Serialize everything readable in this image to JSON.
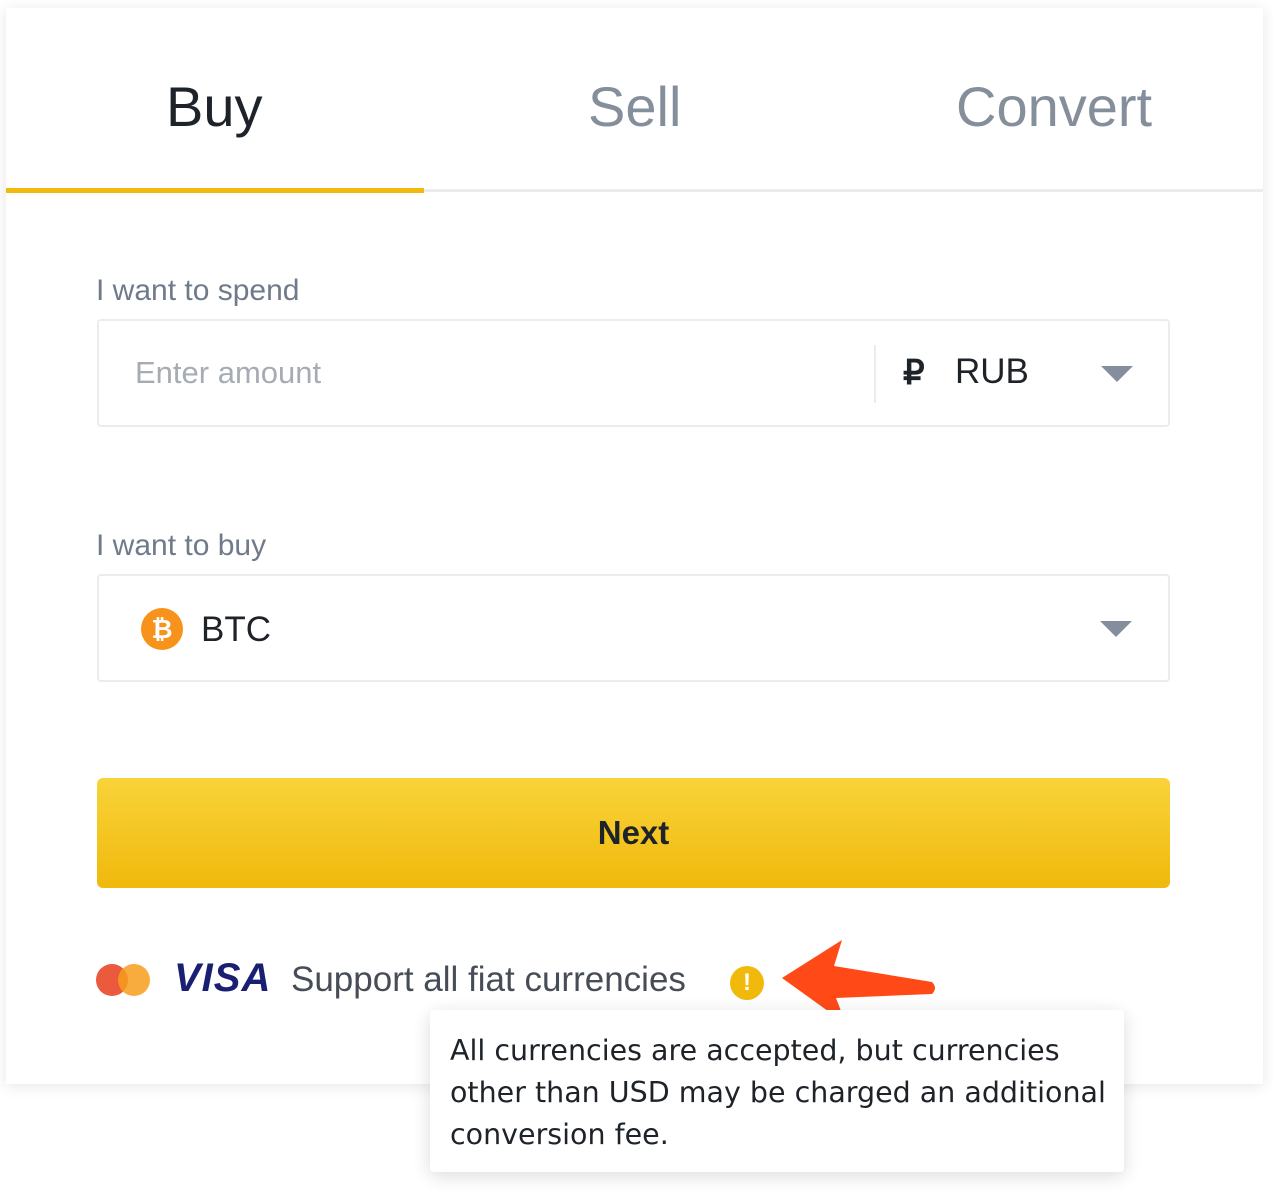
{
  "tabs": [
    {
      "label": "Buy",
      "active": true
    },
    {
      "label": "Sell",
      "active": false
    },
    {
      "label": "Convert",
      "active": false
    }
  ],
  "spend": {
    "label": "I want to spend",
    "placeholder": "Enter amount",
    "value": "",
    "currency_symbol": "₽",
    "currency_code": "RUB"
  },
  "buy": {
    "label": "I want to buy",
    "asset_icon_glyph": "₿",
    "asset_code": "BTC"
  },
  "next_label": "Next",
  "payment": {
    "visa_label": "VISA",
    "support_text": "Support all fiat currencies",
    "info_glyph": "!"
  },
  "tooltip": {
    "lines": [
      "All currencies are accepted, but currencies",
      "other than USD may be charged an additional",
      "conversion fee."
    ]
  },
  "colors": {
    "accent": "#f0b90b",
    "text_primary": "#1e2329",
    "text_muted": "#858e9b",
    "annotation_arrow": "#ff4a17"
  },
  "icons": {
    "caret": "chevron-down-icon",
    "asset": "bitcoin-icon",
    "card_brand": "mastercard-icon",
    "info": "info-icon",
    "annotation": "red-arrow-icon"
  }
}
